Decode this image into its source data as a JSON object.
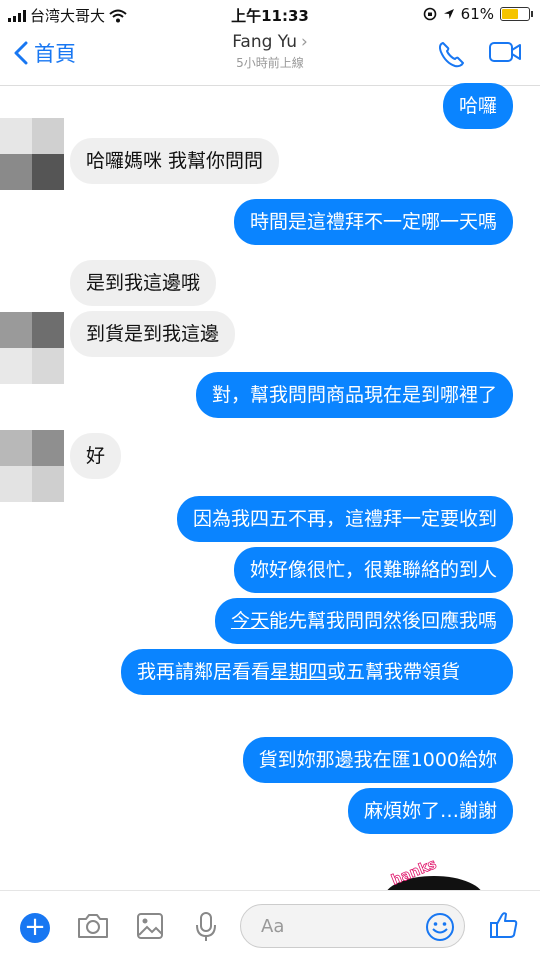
{
  "status_bar": {
    "carrier": "台湾大哥大",
    "time": "上午11:33",
    "battery": "61%",
    "battery_level": 0.61
  },
  "header": {
    "back_label": "首頁",
    "contact_name": "Fang Yu",
    "last_seen": "5小時前上線"
  },
  "messages": [
    {
      "dir": "out",
      "text": "哈囉"
    },
    {
      "dir": "in",
      "text": "哈囉媽咪 我幫你問問"
    },
    {
      "dir": "out",
      "text": "時間是這禮拜不一定哪一天嗎"
    },
    {
      "dir": "in",
      "text": "是到我這邊哦"
    },
    {
      "dir": "in",
      "text": "到貨是到我這邊"
    },
    {
      "dir": "out",
      "text": "對，幫我問問商品現在是到哪裡了"
    },
    {
      "dir": "in",
      "text": "好"
    },
    {
      "dir": "out",
      "text": "因為我四五不再，這禮拜一定要收到"
    },
    {
      "dir": "out",
      "text": "妳好像很忙，很難聯絡的到人"
    },
    {
      "dir": "out",
      "text_underlined": "今天",
      "text_rest": "能先幫我問問然後回應我嗎"
    },
    {
      "dir": "out",
      "text_before": "我再請鄰居看看",
      "text_underlined": "星期四",
      "text_after": "或五幫我帶領貨"
    },
    {
      "dir": "out",
      "text": "貨到妳那邊我在匯1000給妳"
    },
    {
      "dir": "out",
      "text": "麻煩妳了…謝謝"
    }
  ],
  "sticker_text": "hanks",
  "composer": {
    "placeholder": "Aa"
  },
  "colors": {
    "accent": "#1877f2",
    "outgoing_bubble": "#0a84ff",
    "incoming_bubble": "#efefef"
  },
  "icons": [
    "plus-icon",
    "camera-icon",
    "image-icon",
    "microphone-icon",
    "emoji-icon",
    "thumbs-up-icon",
    "phone-icon",
    "video-icon",
    "back-chevron-icon",
    "wifi-icon",
    "location-icon"
  ]
}
